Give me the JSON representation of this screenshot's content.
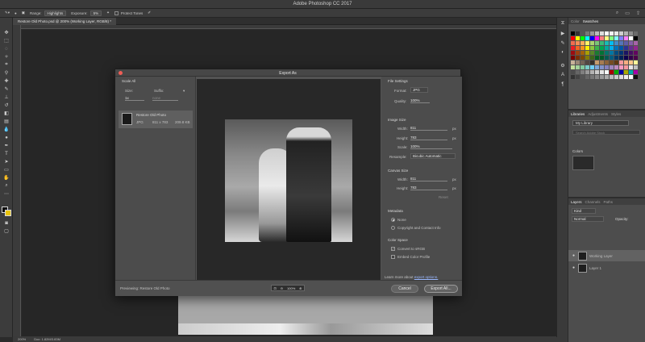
{
  "app": {
    "title": "Adobe Photoshop CC 2017"
  },
  "options_bar": {
    "range_label": "Range:",
    "range_value": "Highlights",
    "exposure_label": "Exposure:",
    "exposure_value": "5%",
    "protect_tones": "Protect Tones"
  },
  "document": {
    "tab_title": "Restore Old Photo.psd @ 200% (Working Layer, RGB/8) *"
  },
  "status": {
    "zoom": "200%",
    "doc": "Doc: 1.82M/3.83M"
  },
  "panels": {
    "color_tabs": [
      "Color",
      "Swatches"
    ],
    "library_tabs": [
      "Libraries",
      "Adjustments",
      "Styles"
    ],
    "library_name": "My Library",
    "library_search": "Search Adobe Stock",
    "library_section": "Colors",
    "layers_tabs": [
      "Layers",
      "Channels",
      "Paths"
    ],
    "layers_kind": "Kind",
    "layers_mode": "Normal",
    "layers_opacity": "Opacity:",
    "layers": [
      {
        "name": "Working Layer"
      },
      {
        "name": "Layer 1"
      }
    ]
  },
  "dialog": {
    "title": "Export As",
    "scale_all": "Scale All",
    "size_label": "Size:",
    "suffix_label": "Suffix:",
    "size_value": "1x",
    "suffix_placeholder": "none",
    "file_name": "Restore Old Photo",
    "file_format": "JPG",
    "file_dims": "811 x 783",
    "file_size": "209.8 KB",
    "file_settings": "File Settings",
    "format_label": "Format:",
    "format_value": "JPG",
    "quality_label": "Quality:",
    "quality_value": "100%",
    "image_size": "Image Size",
    "width_label": "Width:",
    "width_value": "811",
    "height_label": "Height:",
    "height_value": "783",
    "scale_label": "Scale:",
    "scale_value": "100%",
    "unit_px": "px",
    "resample_label": "Resample:",
    "resample_value": "Bicubic Automatic",
    "canvas_size": "Canvas Size",
    "canvas_width": "811",
    "canvas_height": "783",
    "reset_label": "Reset",
    "metadata": "Metadata",
    "meta_none": "None",
    "meta_copyright": "Copyright and Contact Info",
    "color_space": "Color Space",
    "convert_srgb": "Convert to sRGB",
    "embed_profile": "Embed Color Profile",
    "learn_more": "Learn more about",
    "export_options": "export options.",
    "previewing": "Previewing: Restore Old Photo",
    "zoom_value": "100%",
    "cancel": "Cancel",
    "export_all": "Export All..."
  }
}
